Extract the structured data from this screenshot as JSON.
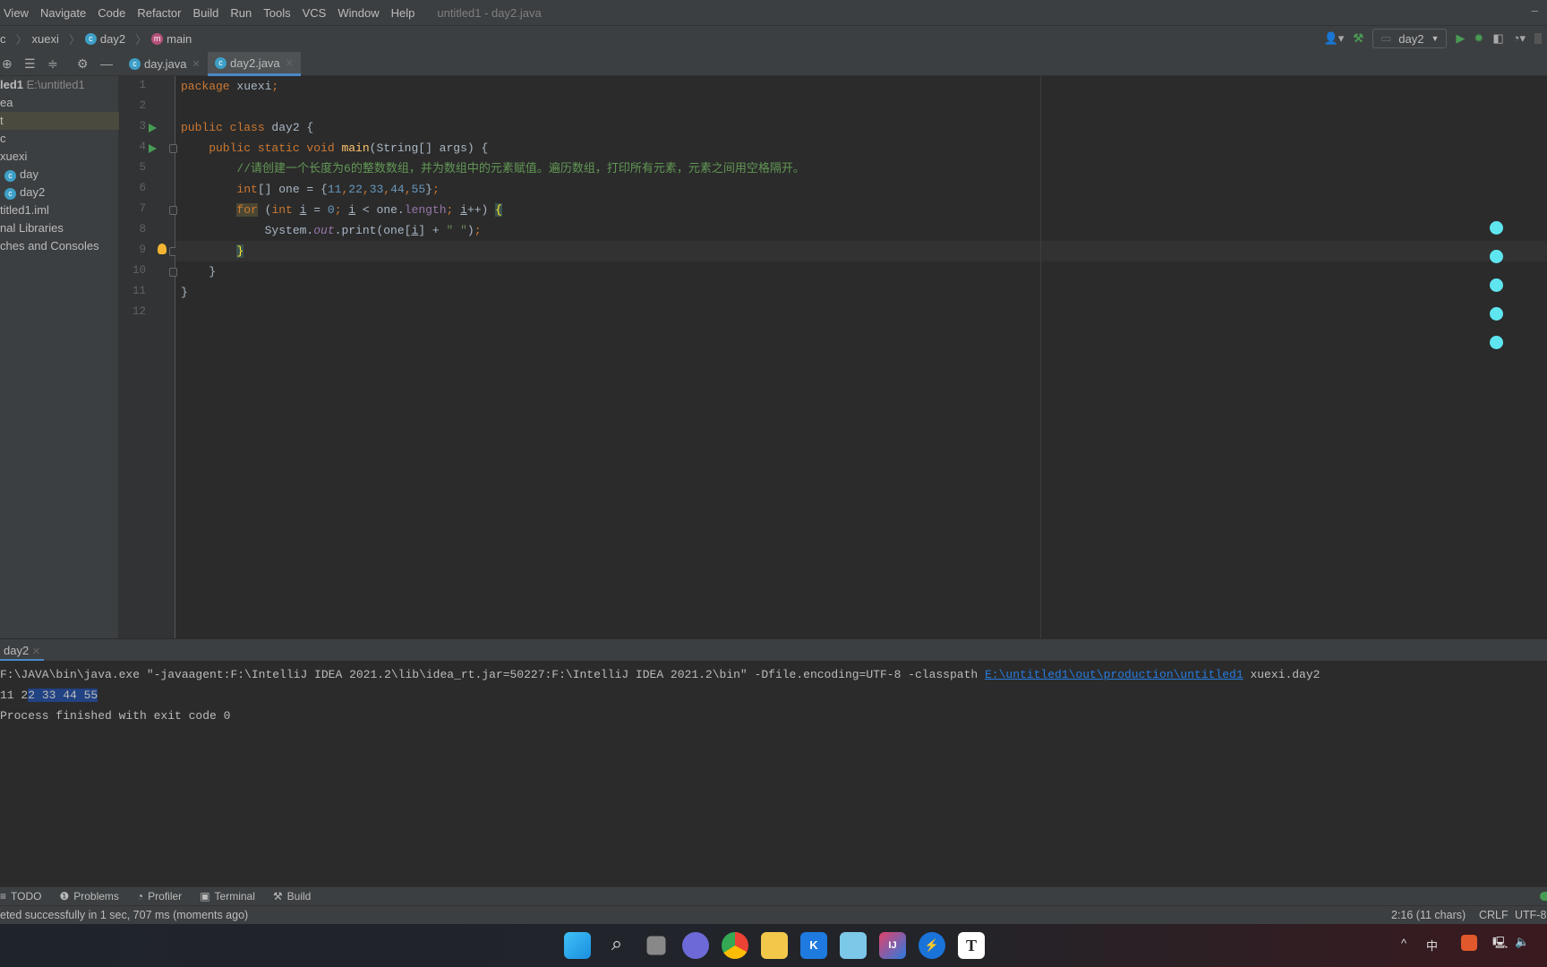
{
  "menu": {
    "items": [
      "View",
      "Navigate",
      "Code",
      "Refactor",
      "Build",
      "Run",
      "Tools",
      "VCS",
      "Window",
      "Help"
    ],
    "title": "untitled1 - day2.java"
  },
  "breadcrumb": [
    "c",
    "xuexi",
    "day2",
    "main"
  ],
  "run_config": {
    "name": "day2"
  },
  "tabs": [
    {
      "label": "day.java",
      "active": false
    },
    {
      "label": "day2.java",
      "active": true
    }
  ],
  "project": {
    "root": "led1",
    "root_path": "E:\\untitled1",
    "items": [
      "ea",
      "t",
      "c",
      "xuexi",
      "day",
      "day2",
      "titled1.iml",
      "nal Libraries",
      "ches and Consoles"
    ]
  },
  "code": {
    "lines": [
      [
        [
          "package",
          "kw"
        ],
        [
          " xuexi",
          ""
        ],
        [
          ";",
          "kw"
        ]
      ],
      [],
      [
        [
          "public class ",
          "kw"
        ],
        [
          "day2 {",
          ""
        ]
      ],
      [
        [
          "    public static void ",
          "kw"
        ],
        [
          "main",
          "fn"
        ],
        [
          "(String[] args) {",
          ""
        ]
      ],
      [
        [
          "        //请创建一个长度为6的整数数组，并为数组中的元素赋值。遍历数组，打印所有元素，元素之间用空格隔开。",
          "cm"
        ]
      ],
      [
        [
          "        ",
          ""
        ],
        [
          "int",
          "kw"
        ],
        [
          "[] one = {",
          ""
        ],
        [
          "11",
          "num"
        ],
        [
          ",",
          "kw"
        ],
        [
          "22",
          "num"
        ],
        [
          ",",
          "kw"
        ],
        [
          "33",
          "num"
        ],
        [
          ",",
          "kw"
        ],
        [
          "44",
          "num"
        ],
        [
          ",",
          "kw"
        ],
        [
          "55",
          "num"
        ],
        [
          "}",
          ""
        ],
        [
          ";",
          "kw"
        ]
      ],
      [
        [
          "        ",
          ""
        ],
        [
          "for",
          "kw forhl"
        ],
        [
          " (",
          ""
        ],
        [
          "int ",
          "kw"
        ],
        [
          "i",
          "ul"
        ],
        [
          " = ",
          ""
        ],
        [
          "0",
          "num"
        ],
        [
          "; ",
          "kw"
        ],
        [
          "i",
          "ul"
        ],
        [
          " < one.",
          ""
        ],
        [
          "length",
          "fld"
        ],
        [
          "; ",
          "kw"
        ],
        [
          "i",
          "ul"
        ],
        [
          "++) ",
          ""
        ],
        [
          "{",
          "brhl"
        ]
      ],
      [
        [
          "            System.",
          ""
        ],
        [
          "out",
          "it"
        ],
        [
          ".print(one[",
          ""
        ],
        [
          "i",
          "ul"
        ],
        [
          "] + ",
          ""
        ],
        [
          "\" \"",
          "str"
        ],
        [
          ")",
          ""
        ],
        [
          ";",
          "kw"
        ]
      ],
      [
        [
          "        ",
          ""
        ],
        [
          "}",
          "brhl"
        ]
      ],
      [
        [
          "    }",
          ""
        ]
      ],
      [
        [
          "}",
          ""
        ]
      ],
      []
    ]
  },
  "run_panel": {
    "tab": "day2",
    "command_prefix": "F:\\JAVA\\bin\\java.exe \"-javaagent:F:\\IntelliJ IDEA 2021.2\\lib\\idea_rt.jar=50227:F:\\IntelliJ IDEA 2021.2\\bin\" -Dfile.encoding=UTF-8 -classpath ",
    "classpath_link": "E:\\untitled1\\out\\production\\untitled1",
    "command_suffix": " xuexi.day2",
    "output_a": "11 2",
    "output_b": "2 33 44 55",
    "exit": "Process finished with exit code 0"
  },
  "bottom_tools": [
    "TODO",
    "Problems",
    "Profiler",
    "Terminal",
    "Build"
  ],
  "status": {
    "message": "eted successfully in 1 sec, 707 ms (moments ago)",
    "position": "2:16 (11 chars)",
    "line_sep": "CRLF",
    "encoding": "UTF-8"
  },
  "tray": {
    "ime": "中"
  },
  "colors": {
    "accent": "#4a88c7",
    "run_green": "#499c54",
    "keyword": "#cc7832",
    "comment": "#629755",
    "number": "#6897bb",
    "overlay_dot": "#5ee5f0"
  }
}
